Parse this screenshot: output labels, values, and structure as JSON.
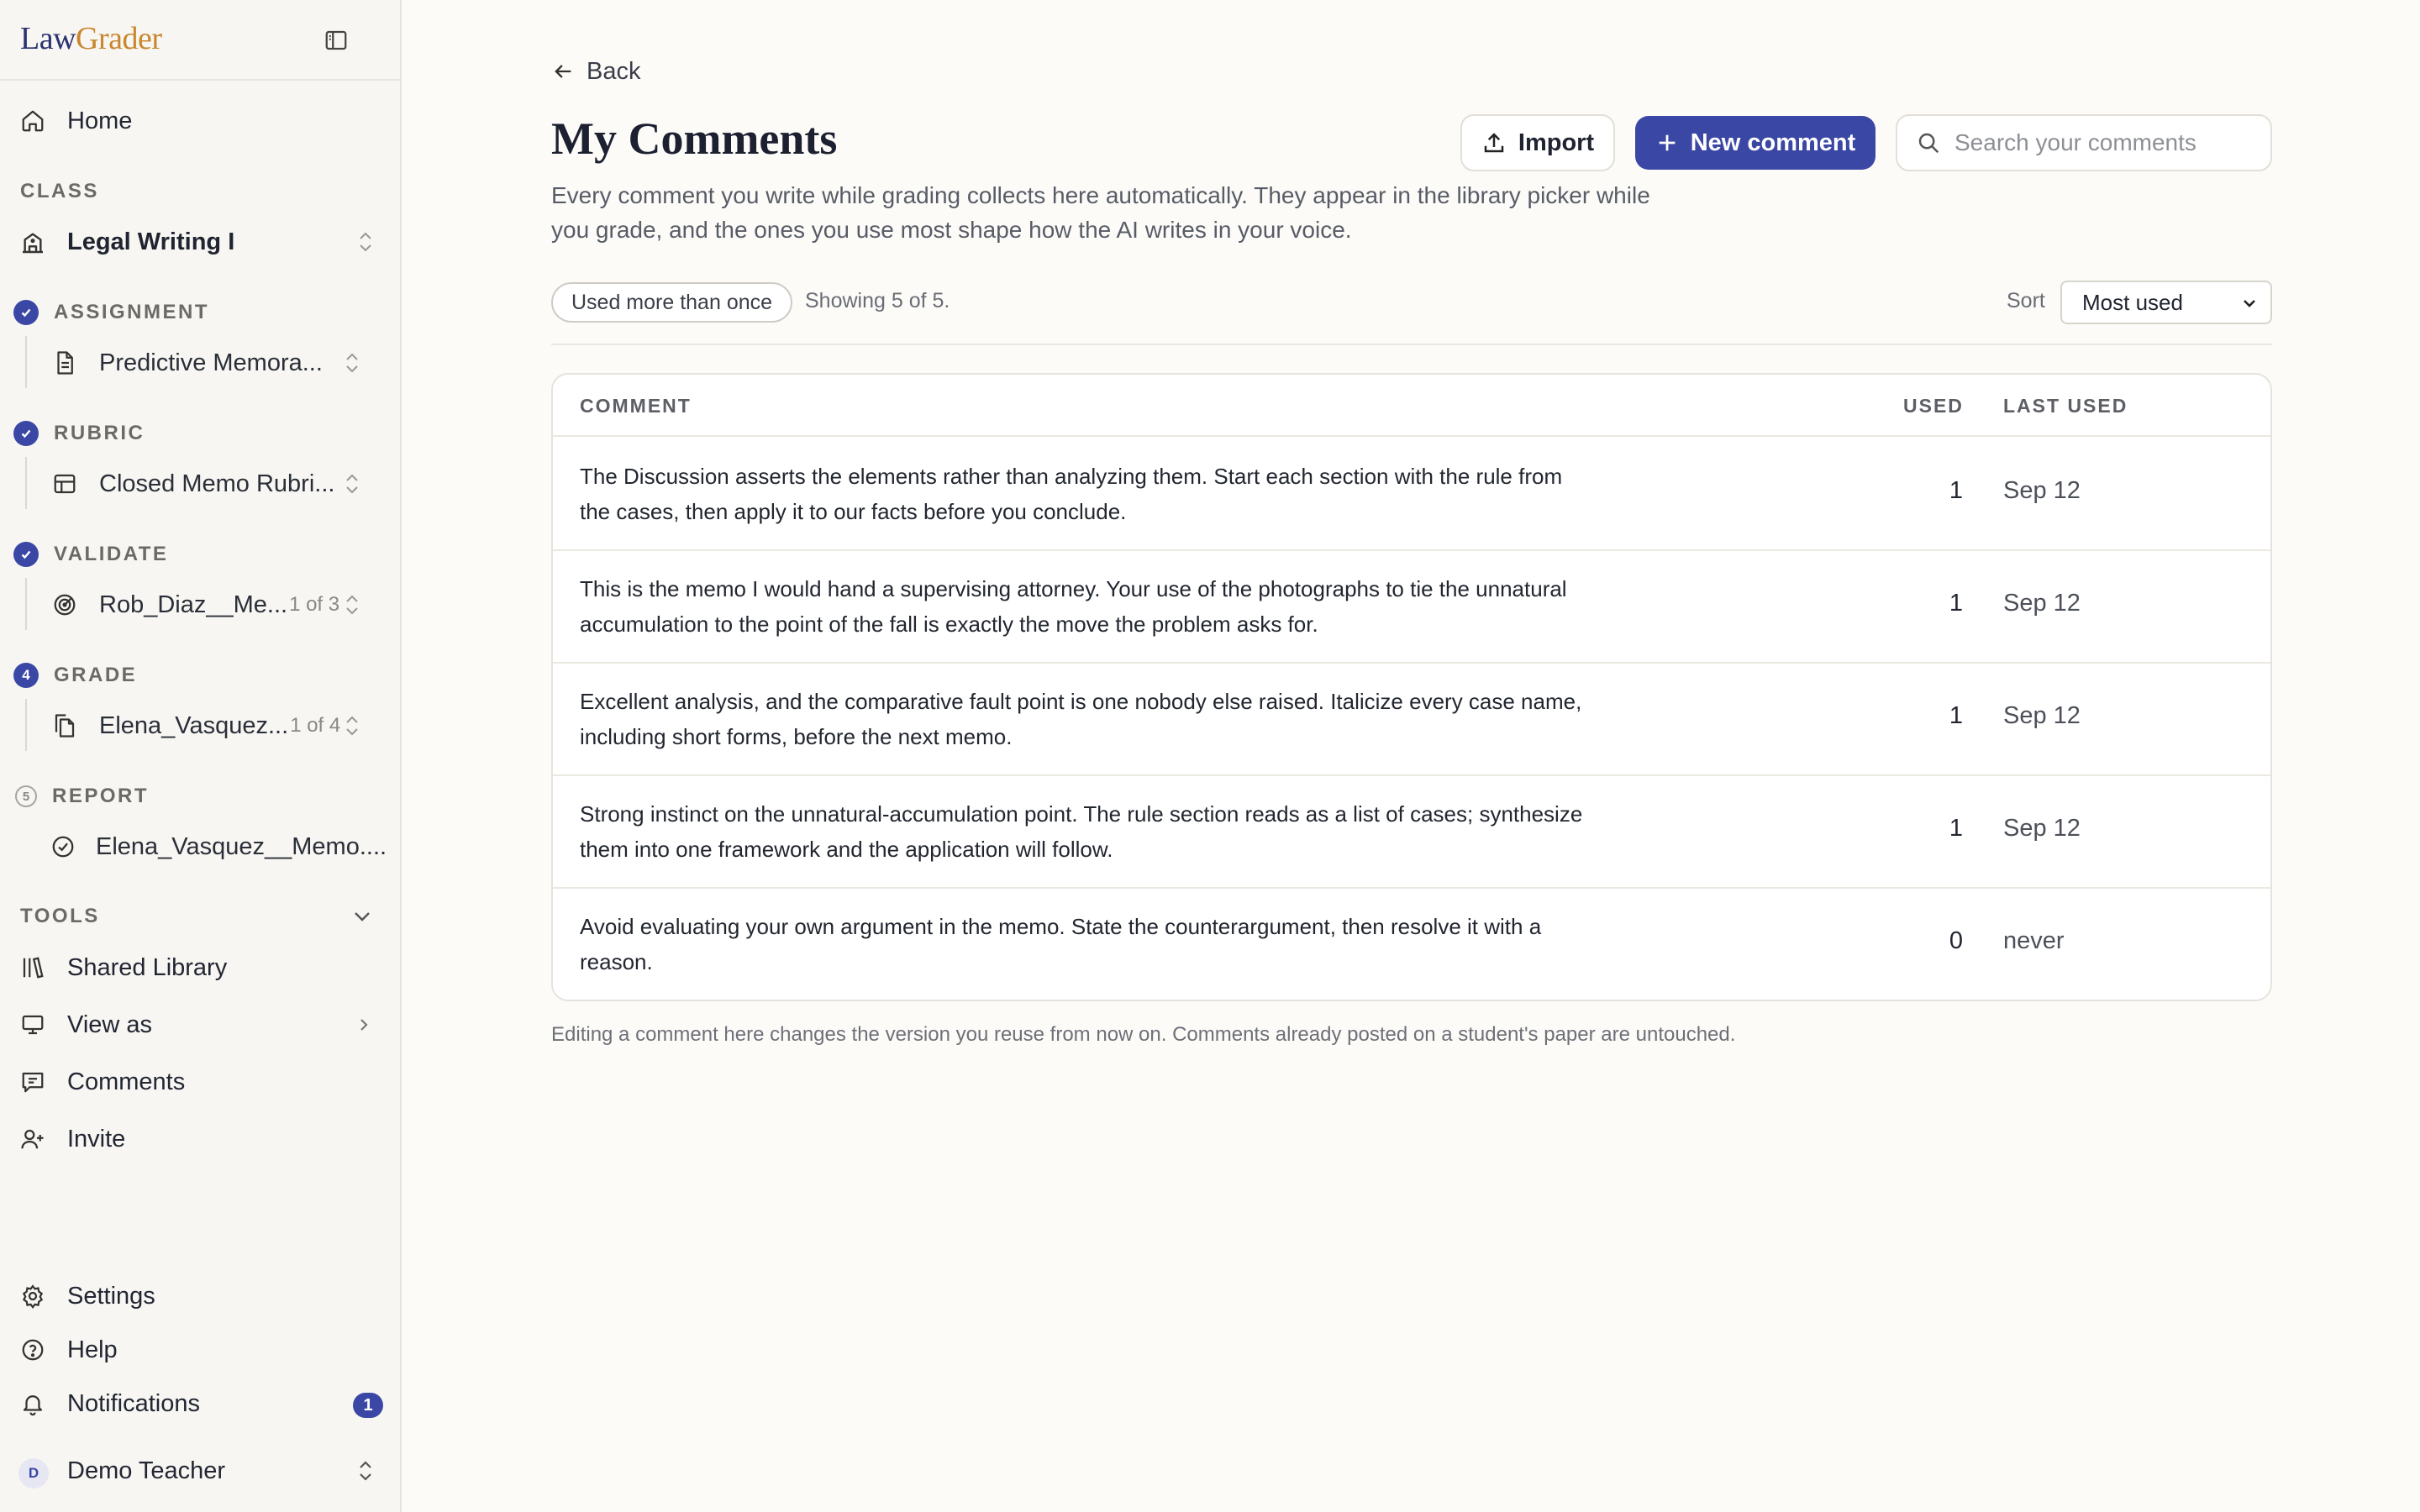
{
  "brand": {
    "law": "Law",
    "grader": "Grader"
  },
  "nav": {
    "home": "Home"
  },
  "sections": {
    "class": "CLASS",
    "tools": "TOOLS"
  },
  "class_item": {
    "label": "Legal Writing I"
  },
  "steps": [
    {
      "badge": "",
      "title": "ASSIGNMENT",
      "item": "Predictive Memora...",
      "sub": ""
    },
    {
      "badge": "",
      "title": "RUBRIC",
      "item": "Closed Memo Rubri...",
      "sub": ""
    },
    {
      "badge": "",
      "title": "VALIDATE",
      "item": "Rob_Diaz__Me...",
      "sub": "1 of 3"
    },
    {
      "badge": "4",
      "title": "GRADE",
      "item": "Elena_Vasquez...",
      "sub": "1 of 4"
    },
    {
      "badge": "5",
      "title": "REPORT",
      "item": "Elena_Vasquez__Memo....",
      "sub": ""
    }
  ],
  "tools": [
    {
      "label": "Shared Library",
      "icon": "library-icon"
    },
    {
      "label": "View as",
      "icon": "monitor-icon"
    },
    {
      "label": "Comments",
      "icon": "comment-icon"
    },
    {
      "label": "Invite",
      "icon": "user-plus-icon"
    }
  ],
  "footer_nav": {
    "settings": "Settings",
    "help": "Help",
    "notifications": "Notifications",
    "notifications_count": "1",
    "user_initial": "D",
    "user_name": "Demo Teacher"
  },
  "main": {
    "back": "Back",
    "title": "My Comments",
    "description": "Every comment you write while grading collects here automatically. They appear in the library picker while you grade, and the ones you use most shape how the AI writes in your voice.",
    "import_label": "Import",
    "new_label": "New comment",
    "search_placeholder": "Search your comments",
    "filter_chip": "Used more than once",
    "showing": "Showing 5 of 5.",
    "sort_label": "Sort",
    "sort_value": "Most used",
    "columns": {
      "comment": "COMMENT",
      "used": "USED",
      "last_used": "LAST USED"
    },
    "rows": [
      {
        "comment": "The Discussion asserts the elements rather than analyzing them. Start each section with the rule from the cases, then apply it to our facts before you conclude.",
        "used": "1",
        "last_used": "Sep 12"
      },
      {
        "comment": "This is the memo I would hand a supervising attorney. Your use of the photographs to tie the unnatural accumulation to the point of the fall is exactly the move the problem asks for.",
        "used": "1",
        "last_used": "Sep 12"
      },
      {
        "comment": "Excellent analysis, and the comparative fault point is one nobody else raised. Italicize every case name, including short forms, before the next memo.",
        "used": "1",
        "last_used": "Sep 12"
      },
      {
        "comment": "Strong instinct on the unnatural-accumulation point. The rule section reads as a list of cases; synthesize them into one framework and the application will follow.",
        "used": "1",
        "last_used": "Sep 12"
      },
      {
        "comment": "Avoid evaluating your own argument in the memo. State the counterargument, then resolve it with a reason.",
        "used": "0",
        "last_used": "never"
      }
    ],
    "footnote": "Editing a comment here changes the version you reuse from now on. Comments already posted on a student's paper are untouched."
  },
  "colors": {
    "accent": "#3b47a5",
    "brand_gold": "#c9872f",
    "brand_navy": "#2b3270",
    "background": "#fcfbf8",
    "sidebar": "#f7f6f2"
  }
}
